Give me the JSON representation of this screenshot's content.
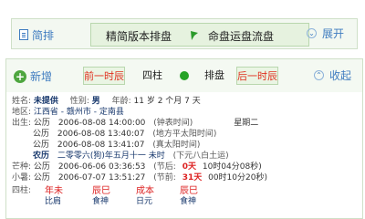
{
  "tabs": {
    "simple": "简排",
    "precise": "精简版本排盘",
    "fate": "命盘运盘流盘",
    "expand": "展开"
  },
  "toolbar": {
    "add": "新增",
    "prev_hour": "前一时辰",
    "four_pillars": "四柱",
    "chart": "排盘",
    "next_hour": "后一时辰",
    "collapse": "收起"
  },
  "info": {
    "name_label": "姓名:",
    "name": "未提供",
    "gender_label": "性别:",
    "gender": "男",
    "age_label": "年龄:",
    "age": "11 岁 2 个月 7 天",
    "region_label": "地区:",
    "region": "江西省 - 赣州市 - 定南县",
    "birth_label": "出生:",
    "b1_cal": "公历",
    "b1_date": "2006-08-08 14:00:00",
    "b1_note": "(钟表时间)",
    "b1_weekday": "星期二",
    "b2_cal": "公历",
    "b2_date": "2006-08-08 13:40:07",
    "b2_note": "(地方平太阳时间)",
    "b3_cal": "公历",
    "b3_date": "2006-08-08 13:41:07",
    "b3_note": "(真太阳时间)",
    "lunar_cal": "农历",
    "lunar_date": "二零零六(狗)年五月十一 未时",
    "lunar_note": "(下元八白土运)",
    "mangzhong_label": "芒种:",
    "mz_cal": "公历",
    "mz_date": "2006-06-06 03:36:53",
    "mz_note_pre": "(节后:",
    "mz_days": "0天",
    "mz_time": "10时04分08秒)",
    "xiaoshu_label": "小暑:",
    "xs_cal": "公历",
    "xs_date": "2006-07-07 13:51:27",
    "xs_note_pre": "(节前:",
    "xs_days": "31天",
    "xs_time": "00时10分20秒)",
    "pillars_label": "四柱:",
    "pillars": [
      "年未",
      "辰巳",
      "成本",
      "辰巳"
    ],
    "pillars_sub": [
      "比肩",
      "食神",
      "日元",
      "食神"
    ]
  }
}
